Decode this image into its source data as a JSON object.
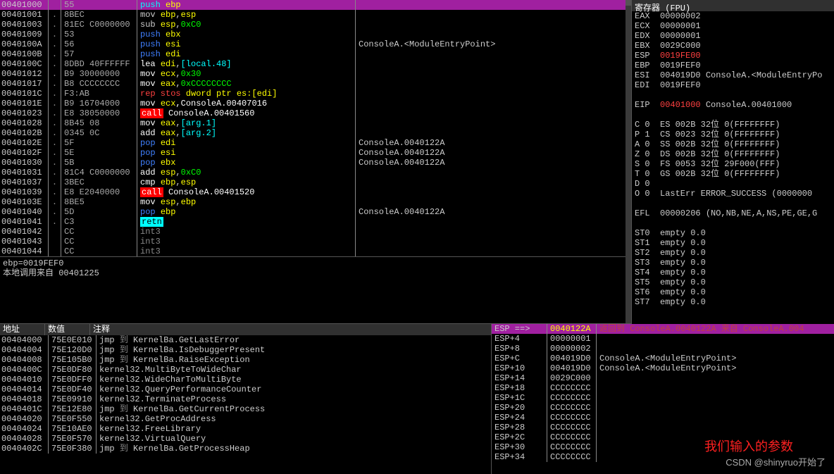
{
  "cpu": {
    "rows": [
      {
        "addr": "00401000",
        "mark": "",
        "hex": "55",
        "asm": [
          {
            "t": "push ",
            "c": "cyan"
          },
          {
            "t": "ebp",
            "c": "yellow"
          }
        ],
        "cmt": "",
        "sel": true
      },
      {
        "addr": "00401001",
        "mark": ".",
        "hex": "8BEC",
        "asm": [
          {
            "t": "mov ",
            "c": ""
          },
          {
            "t": "ebp",
            "c": "yellow"
          },
          {
            "t": ",",
            "c": ""
          },
          {
            "t": "esp",
            "c": "yellow"
          }
        ],
        "cmt": ""
      },
      {
        "addr": "00401003",
        "mark": ".",
        "hex": "81EC C0000000",
        "asm": [
          {
            "t": "sub ",
            "c": ""
          },
          {
            "t": "esp",
            "c": "yellow"
          },
          {
            "t": ",",
            "c": ""
          },
          {
            "t": "0xC0",
            "c": "green"
          }
        ],
        "cmt": ""
      },
      {
        "addr": "00401009",
        "mark": ".",
        "hex": "53",
        "asm": [
          {
            "t": "push ",
            "c": "blue"
          },
          {
            "t": "ebx",
            "c": "yellow"
          }
        ],
        "cmt": ""
      },
      {
        "addr": "0040100A",
        "mark": ".",
        "hex": "56",
        "asm": [
          {
            "t": "push ",
            "c": "blue"
          },
          {
            "t": "esi",
            "c": "yellow"
          }
        ],
        "cmt": "ConsoleA.<ModuleEntryPoint>"
      },
      {
        "addr": "0040100B",
        "mark": ".",
        "hex": "57",
        "asm": [
          {
            "t": "push ",
            "c": "blue"
          },
          {
            "t": "edi",
            "c": "yellow"
          }
        ],
        "cmt": ""
      },
      {
        "addr": "0040100C",
        "mark": ".",
        "hex": "8DBD 40FFFFFF",
        "asm": [
          {
            "t": "lea ",
            "c": "white"
          },
          {
            "t": "edi",
            "c": "yellow"
          },
          {
            "t": ",",
            "c": ""
          },
          {
            "t": "[local.48]",
            "c": "cyan"
          }
        ],
        "cmt": ""
      },
      {
        "addr": "00401012",
        "mark": ".",
        "hex": "B9 30000000",
        "asm": [
          {
            "t": "mov ",
            "c": "white"
          },
          {
            "t": "ecx",
            "c": "yellow"
          },
          {
            "t": ",",
            "c": ""
          },
          {
            "t": "0x30",
            "c": "green"
          }
        ],
        "cmt": ""
      },
      {
        "addr": "00401017",
        "mark": ".",
        "hex": "B8 CCCCCCCC",
        "asm": [
          {
            "t": "mov ",
            "c": "white"
          },
          {
            "t": "eax",
            "c": "yellow"
          },
          {
            "t": ",",
            "c": ""
          },
          {
            "t": "0xCCCCCCCC",
            "c": "green"
          }
        ],
        "cmt": ""
      },
      {
        "addr": "0040101C",
        "mark": ".",
        "hex": "F3:AB",
        "asm": [
          {
            "t": "rep stos ",
            "c": "red"
          },
          {
            "t": "dword ptr es:[edi]",
            "c": "yellow"
          }
        ],
        "cmt": ""
      },
      {
        "addr": "0040101E",
        "mark": ".",
        "hex": "B9 16704000",
        "asm": [
          {
            "t": "mov ",
            "c": "white"
          },
          {
            "t": "ecx",
            "c": "yellow"
          },
          {
            "t": ",ConsoleA.00407016",
            "c": "white"
          }
        ],
        "cmt": ""
      },
      {
        "addr": "00401023",
        "mark": ".",
        "hex": "E8 38050000",
        "asm": [
          {
            "t": "call",
            "c": "redbg"
          },
          {
            "t": " ConsoleA.00401560",
            "c": "white"
          }
        ],
        "cmt": ""
      },
      {
        "addr": "00401028",
        "mark": ".",
        "hex": "8B45 08",
        "asm": [
          {
            "t": "mov ",
            "c": "white"
          },
          {
            "t": "eax",
            "c": "yellow"
          },
          {
            "t": ",",
            "c": ""
          },
          {
            "t": "[arg.1]",
            "c": "cyan"
          }
        ],
        "cmt": ""
      },
      {
        "addr": "0040102B",
        "mark": ".",
        "hex": "0345 0C",
        "asm": [
          {
            "t": "add ",
            "c": "white"
          },
          {
            "t": "eax",
            "c": "yellow"
          },
          {
            "t": ",",
            "c": ""
          },
          {
            "t": "[arg.2]",
            "c": "cyan"
          }
        ],
        "cmt": ""
      },
      {
        "addr": "0040102E",
        "mark": ".",
        "hex": "5F",
        "asm": [
          {
            "t": "pop ",
            "c": "blue"
          },
          {
            "t": "edi",
            "c": "yellow"
          }
        ],
        "cmt": "ConsoleA.0040122A"
      },
      {
        "addr": "0040102F",
        "mark": ".",
        "hex": "5E",
        "asm": [
          {
            "t": "pop ",
            "c": "blue"
          },
          {
            "t": "esi",
            "c": "yellow"
          }
        ],
        "cmt": "ConsoleA.0040122A"
      },
      {
        "addr": "00401030",
        "mark": ".",
        "hex": "5B",
        "asm": [
          {
            "t": "pop ",
            "c": "blue"
          },
          {
            "t": "ebx",
            "c": "yellow"
          }
        ],
        "cmt": "ConsoleA.0040122A"
      },
      {
        "addr": "00401031",
        "mark": ".",
        "hex": "81C4 C0000000",
        "asm": [
          {
            "t": "add ",
            "c": "white"
          },
          {
            "t": "esp",
            "c": "yellow"
          },
          {
            "t": ",",
            "c": ""
          },
          {
            "t": "0xC0",
            "c": "green"
          }
        ],
        "cmt": ""
      },
      {
        "addr": "00401037",
        "mark": ".",
        "hex": "3BEC",
        "asm": [
          {
            "t": "cmp ",
            "c": "white"
          },
          {
            "t": "ebp",
            "c": "yellow"
          },
          {
            "t": ",",
            "c": ""
          },
          {
            "t": "esp",
            "c": "yellow"
          }
        ],
        "cmt": ""
      },
      {
        "addr": "00401039",
        "mark": ".",
        "hex": "E8 E2040000",
        "asm": [
          {
            "t": "call",
            "c": "redbg"
          },
          {
            "t": " ConsoleA.00401520",
            "c": "white"
          }
        ],
        "cmt": ""
      },
      {
        "addr": "0040103E",
        "mark": ".",
        "hex": "8BE5",
        "asm": [
          {
            "t": "mov ",
            "c": "white"
          },
          {
            "t": "esp",
            "c": "yellow"
          },
          {
            "t": ",",
            "c": ""
          },
          {
            "t": "ebp",
            "c": "yellow"
          }
        ],
        "cmt": ""
      },
      {
        "addr": "00401040",
        "mark": ".",
        "hex": "5D",
        "asm": [
          {
            "t": "pop ",
            "c": "blue"
          },
          {
            "t": "ebp",
            "c": "yellow"
          }
        ],
        "cmt": "ConsoleA.0040122A"
      },
      {
        "addr": "00401041",
        "mark": ".",
        "hex": "C3",
        "asm": [
          {
            "t": "retn",
            "c": "cyanbg"
          }
        ],
        "cmt": ""
      },
      {
        "addr": "00401042",
        "mark": "",
        "hex": "CC",
        "asm": [
          {
            "t": "int3",
            "c": "gray"
          }
        ],
        "cmt": ""
      },
      {
        "addr": "00401043",
        "mark": "",
        "hex": "CC",
        "asm": [
          {
            "t": "int3",
            "c": "gray"
          }
        ],
        "cmt": ""
      },
      {
        "addr": "00401044",
        "mark": "",
        "hex": "CC",
        "asm": [
          {
            "t": "int3",
            "c": "gray"
          }
        ],
        "cmt": ""
      }
    ],
    "info1": "ebp=0019FEF0",
    "info2": "本地调用来自  00401225"
  },
  "registers": {
    "title": "寄存器 (FPU)",
    "lines": [
      "EAX  00000002",
      "ECX  00000001",
      "EDX  00000001",
      "EBX  0029C000",
      {
        "pre": "ESP  ",
        "val": "0019FE00",
        "c": "red"
      },
      "EBP  0019FEF0",
      "ESI  004019D0 ConsoleA.<ModuleEntryPo",
      "EDI  0019FEF0",
      "",
      {
        "pre": "EIP  ",
        "val": "00401000",
        "c": "red",
        "post": " ConsoleA.00401000"
      },
      "",
      "C 0  ES 002B 32位 0(FFFFFFFF)",
      "P 1  CS 0023 32位 0(FFFFFFFF)",
      "A 0  SS 002B 32位 0(FFFFFFFF)",
      "Z 0  DS 002B 32位 0(FFFFFFFF)",
      "S 0  FS 0053 32位 29F000(FFF)",
      "T 0  GS 002B 32位 0(FFFFFFFF)",
      "D 0",
      "O 0  LastErr ERROR_SUCCESS (0000000",
      "",
      "EFL  00000206 (NO,NB,NE,A,NS,PE,GE,G",
      "",
      "ST0  empty 0.0",
      "ST1  empty 0.0",
      "ST2  empty 0.0",
      "ST3  empty 0.0",
      "ST4  empty 0.0",
      "ST5  empty 0.0",
      "ST6  empty 0.0",
      "ST7  empty 0.0"
    ]
  },
  "dump": {
    "headers": [
      "地址",
      "数值",
      "注释"
    ],
    "rows": [
      {
        "addr": "00404000",
        "val": "75E0E010",
        "cmt": [
          {
            "t": "jmp ",
            "c": ""
          },
          {
            "t": "到",
            "c": "gray"
          },
          {
            "t": " KernelBa.GetLastError",
            "c": ""
          }
        ]
      },
      {
        "addr": "00404004",
        "val": "75E120D0",
        "cmt": [
          {
            "t": "jmp ",
            "c": ""
          },
          {
            "t": "到",
            "c": "gray"
          },
          {
            "t": " KernelBa.IsDebuggerPresent",
            "c": ""
          }
        ]
      },
      {
        "addr": "00404008",
        "val": "75E105B0",
        "cmt": [
          {
            "t": "jmp ",
            "c": ""
          },
          {
            "t": "到",
            "c": "gray"
          },
          {
            "t": " KernelBa.RaiseException",
            "c": ""
          }
        ]
      },
      {
        "addr": "0040400C",
        "val": "75E0DF80",
        "cmt": [
          {
            "t": "kernel32.MultiByteToWideChar",
            "c": ""
          }
        ]
      },
      {
        "addr": "00404010",
        "val": "75E0DFF0",
        "cmt": [
          {
            "t": "kernel32.WideCharToMultiByte",
            "c": ""
          }
        ]
      },
      {
        "addr": "00404014",
        "val": "75E0DF40",
        "cmt": [
          {
            "t": "kernel32.QueryPerformanceCounter",
            "c": ""
          }
        ]
      },
      {
        "addr": "00404018",
        "val": "75E09910",
        "cmt": [
          {
            "t": "kernel32.TerminateProcess",
            "c": ""
          }
        ]
      },
      {
        "addr": "0040401C",
        "val": "75E12E80",
        "cmt": [
          {
            "t": "jmp ",
            "c": ""
          },
          {
            "t": "到",
            "c": "gray"
          },
          {
            "t": " KernelBa.GetCurrentProcess",
            "c": ""
          }
        ]
      },
      {
        "addr": "00404020",
        "val": "75E0F550",
        "cmt": [
          {
            "t": "kernel32.GetProcAddress",
            "c": ""
          }
        ]
      },
      {
        "addr": "00404024",
        "val": "75E10AE0",
        "cmt": [
          {
            "t": "kernel32.FreeLibrary",
            "c": ""
          }
        ]
      },
      {
        "addr": "00404028",
        "val": "75E0F570",
        "cmt": [
          {
            "t": "kernel32.VirtualQuery",
            "c": ""
          }
        ]
      },
      {
        "addr": "0040402C",
        "val": "75E0F380",
        "cmt": [
          {
            "t": "jmp ",
            "c": ""
          },
          {
            "t": "到",
            "c": "gray"
          },
          {
            "t": " KernelBa.GetProcessHeap",
            "c": ""
          }
        ]
      }
    ]
  },
  "stack": {
    "header_left": "ESP ==>",
    "header_mid": "0040122A",
    "header_right": "返回到 ConsoleA.0040122A 来自 ConsoleA.004",
    "rows": [
      {
        "c1": "ESP+4",
        "c2": "00000001",
        "c3": ""
      },
      {
        "c1": "ESP+8",
        "c2": "00000002",
        "c3": ""
      },
      {
        "c1": "ESP+C",
        "c2": "004019D0",
        "c3": "ConsoleA.<ModuleEntryPoint>"
      },
      {
        "c1": "ESP+10",
        "c2": "004019D0",
        "c3": "ConsoleA.<ModuleEntryPoint>"
      },
      {
        "c1": "ESP+14",
        "c2": "0029C000",
        "c3": ""
      },
      {
        "c1": "ESP+18",
        "c2": "CCCCCCCC",
        "c3": ""
      },
      {
        "c1": "ESP+1C",
        "c2": "CCCCCCCC",
        "c3": ""
      },
      {
        "c1": "ESP+20",
        "c2": "CCCCCCCC",
        "c3": ""
      },
      {
        "c1": "ESP+24",
        "c2": "CCCCCCCC",
        "c3": ""
      },
      {
        "c1": "ESP+28",
        "c2": "CCCCCCCC",
        "c3": ""
      },
      {
        "c1": "ESP+2C",
        "c2": "CCCCCCCC",
        "c3": ""
      },
      {
        "c1": "ESP+30",
        "c2": "CCCCCCCC",
        "c3": ""
      },
      {
        "c1": "ESP+34",
        "c2": "CCCCCCCC",
        "c3": ""
      }
    ]
  },
  "annotation_text": "我们输入的参数",
  "watermark": "CSDN @shinyruo开始了"
}
